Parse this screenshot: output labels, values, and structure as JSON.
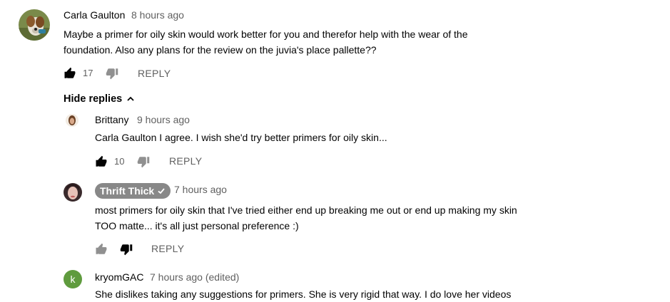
{
  "comment": {
    "author": "Carla Gaulton",
    "time": "8 hours ago",
    "text_line1": "Maybe a primer for oily skin would work better for you and therefor help with the wear of the",
    "text_line2": "foundation. Also any plans for the review on the juvia's place pallette??",
    "likes": "17",
    "reply_label": "REPLY",
    "hide_replies_label": "Hide replies"
  },
  "replies": [
    {
      "author": "Brittany",
      "time": "9 hours ago",
      "text": "Carla Gaulton I agree. I wish she'd try better primers for oily skin...",
      "likes": "10",
      "reply_label": "REPLY"
    },
    {
      "author": "Thrift Thick",
      "time": "7 hours ago",
      "text_line1": "most primers for oily skin that I've tried either end up breaking me out or end up making my skin",
      "text_line2": "TOO matte... it's all just personal preference :)",
      "reply_label": "REPLY",
      "disliked": true
    },
    {
      "author": "kryomGAC",
      "avatar_letter": "k",
      "time": "7 hours ago (edited)",
      "text_line1": "She dislikes taking any suggestions for primers. She is very rigid that way. I do love her videos"
    }
  ],
  "icons": {
    "like": "thumbs-up-icon",
    "dislike": "thumbs-down-icon",
    "chevron": "chevron-up-icon",
    "verified": "check-icon"
  },
  "colors": {
    "badge_bg": "#888888",
    "avatar_green": "#5f9b3e",
    "muted_text": "#606060"
  }
}
